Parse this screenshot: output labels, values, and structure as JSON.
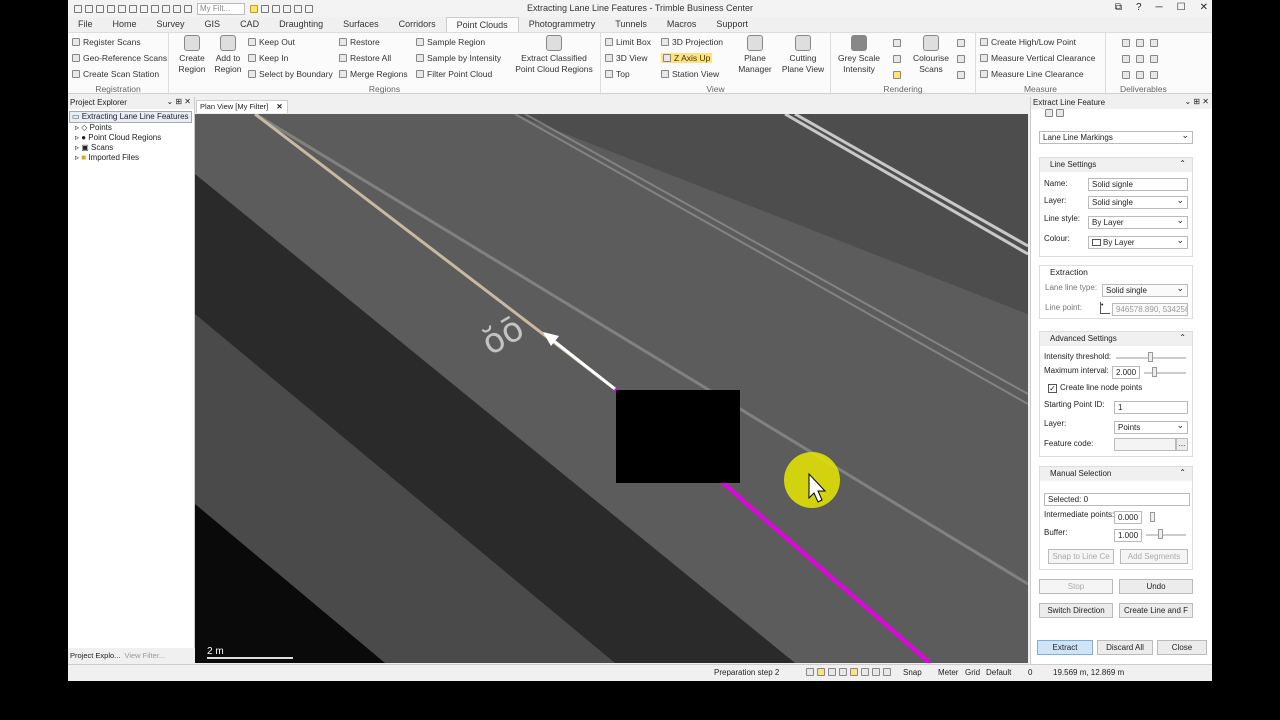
{
  "titlebar": {
    "filter_placeholder": "My Filt...",
    "title": "Extracting Lane Line Features - Trimble Business Center",
    "controls": [
      "⧉",
      "?",
      "─",
      "☐",
      "✕"
    ]
  },
  "menu": [
    "File",
    "Home",
    "Survey",
    "GIS",
    "CAD",
    "Draughting",
    "Surfaces",
    "Corridors",
    "Point Clouds",
    "Photogrammetry",
    "Tunnels",
    "Macros",
    "Support"
  ],
  "menu_active": "Point Clouds",
  "ribbon": {
    "registration": {
      "label": "Registration",
      "items": [
        "Register Scans",
        "Geo-Reference Scans",
        "Create Scan Station"
      ]
    },
    "regions": {
      "label": "Regions",
      "create": [
        "Create",
        "Region"
      ],
      "add": [
        "Add to",
        "Region"
      ],
      "col1": [
        "Keep Out",
        "Keep In",
        "Select by Boundary"
      ],
      "col2": [
        "Restore",
        "Restore All",
        "Merge Regions"
      ],
      "col3": [
        "Sample Region",
        "Sample by Intensity",
        "Filter Point Cloud"
      ],
      "extract": [
        "Extract Classified",
        "Point Cloud Regions"
      ]
    },
    "view": {
      "label": "View",
      "col1": [
        "Limit Box",
        "3D View",
        "Top"
      ],
      "col2": [
        "3D Projection",
        "Z Axis Up",
        "Station View"
      ],
      "plane": [
        "Plane",
        "Manager"
      ],
      "cutting": [
        "Cutting",
        "Plane View"
      ]
    },
    "rendering": {
      "label": "Rendering",
      "grey": [
        "Grey Scale",
        "Intensity"
      ],
      "colour": [
        "Colourise",
        "Scans"
      ]
    },
    "measure": {
      "label": "Measure",
      "items": [
        "Create High/Low Point",
        "Measure Vertical Clearance",
        "Measure Line Clearance"
      ]
    },
    "deliverables": {
      "label": "Deliverables"
    }
  },
  "project_explorer": {
    "title": "Project Explorer",
    "root": "Extracting Lane Line Features",
    "children": [
      "Points",
      "Point Cloud Regions",
      "Scans",
      "Imported Files"
    ],
    "bottom_tabs": [
      "Project Explo...",
      "View Filter..."
    ]
  },
  "view_tab": "Plan View [My Filter]",
  "scale_label": "2 m",
  "panel": {
    "title": "Extract Line Feature",
    "mode": "Lane Line Markings",
    "line_settings": {
      "header": "Line Settings",
      "name_label": "Name:",
      "name": "Solid signle",
      "layer_label": "Layer:",
      "layer": "Solid single",
      "style_label": "Line style:",
      "style": "By Layer",
      "colour_label": "Colour:",
      "colour": "By Layer"
    },
    "extraction": {
      "header": "Extraction",
      "type_label": "Lane line type:",
      "type": "Solid single",
      "point_label": "Line point:",
      "point": "946578.890, 534256"
    },
    "advanced": {
      "header": "Advanced Settings",
      "intensity_label": "Intensity threshold:",
      "interval_label": "Maximum interval:",
      "interval": "2.000",
      "create_nodes": "Create line node points",
      "start_label": "Starting Point ID:",
      "start": "1",
      "layer_label": "Layer:",
      "layer": "Points",
      "code_label": "Feature code:"
    },
    "manual": {
      "header": "Manual Selection",
      "selected": "Selected: 0",
      "inter_label": "Intermediate points:",
      "inter": "0.000",
      "buffer_label": "Buffer:",
      "buffer": "1.000",
      "snap": "Snap to Line Ce",
      "add": "Add Segments"
    },
    "stop": "Stop",
    "undo": "Undo",
    "switch": "Switch Direction",
    "create": "Create Line and F",
    "extract": "Extract",
    "discard": "Discard All",
    "close": "Close"
  },
  "status": {
    "step": "Preparation step 2",
    "snap": "Snap",
    "meter": "Meter",
    "grid": "Grid",
    "default": "Default",
    "zero": "0",
    "coords": "19.569 m, 12.869 m"
  }
}
